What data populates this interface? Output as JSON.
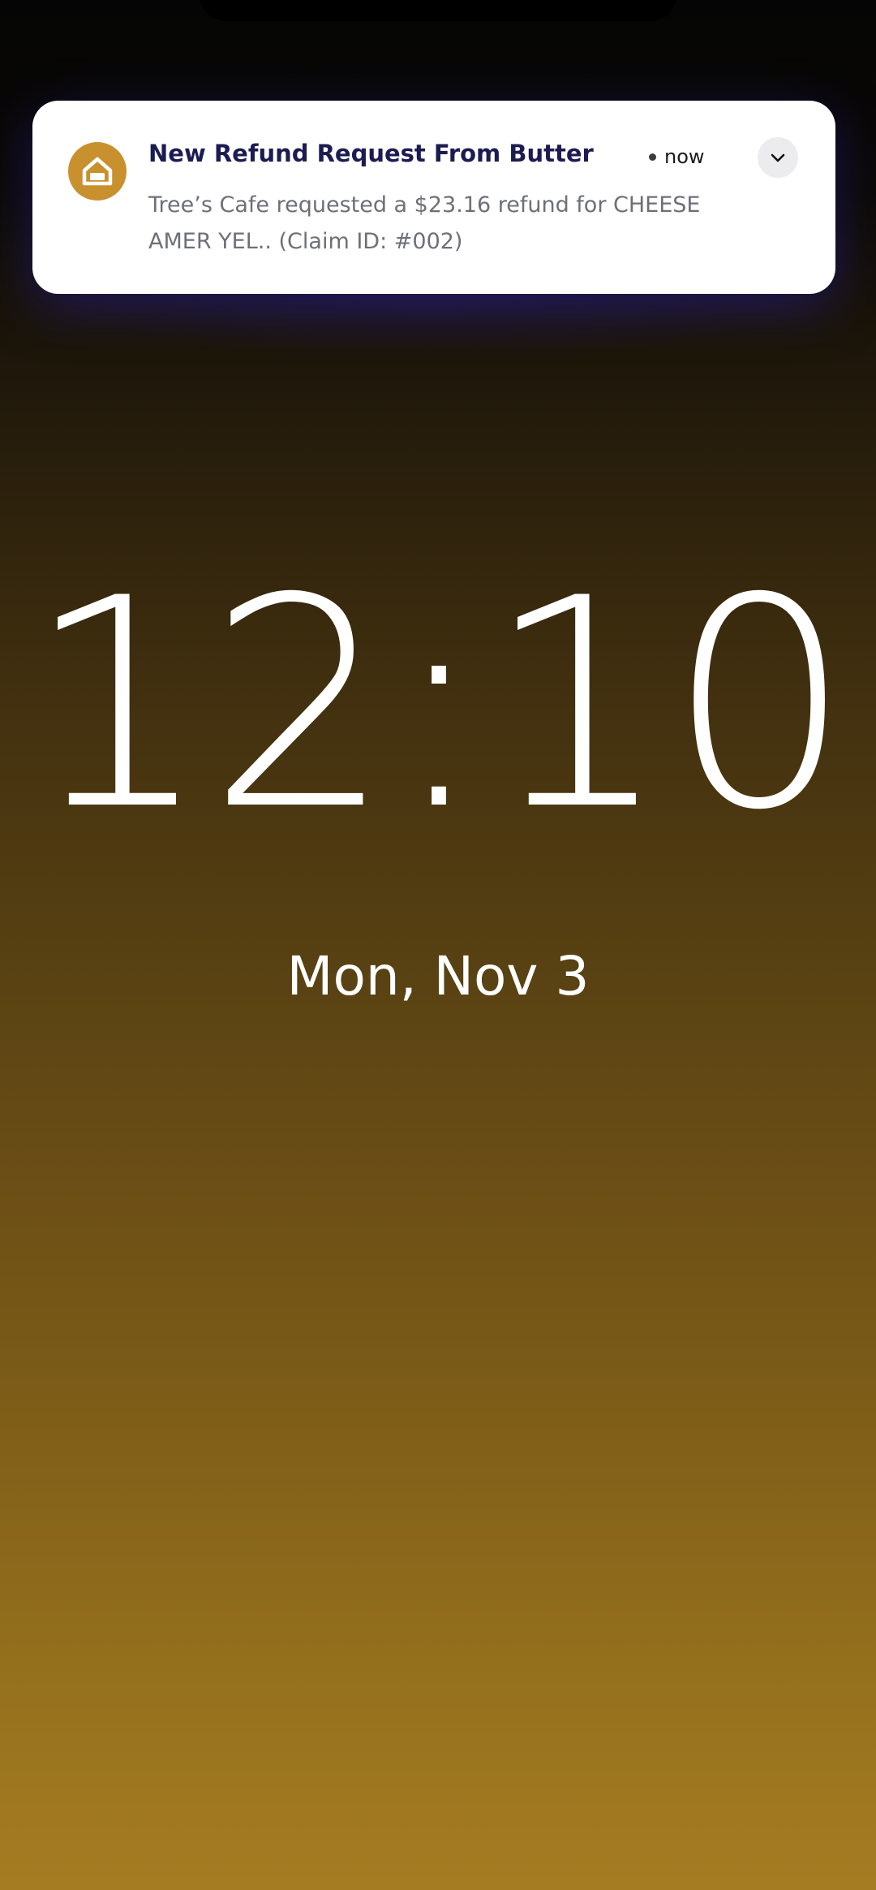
{
  "notification": {
    "app_icon": "house-icon",
    "title": "New Refund Request From Butter",
    "time": "now",
    "body_line1": "Tree’s Cafe requested a $23.16 refund for CHEESE",
    "body_line2": "AMER YEL.. (Claim ID: #002)",
    "expand_icon": "chevron-down-icon"
  },
  "lockscreen": {
    "time": "12:10",
    "date": "Mon, Nov 3"
  },
  "colors": {
    "icon_background": "#c8912e",
    "title_text": "#1c1c52",
    "wallpaper_top": "#050505",
    "wallpaper_bottom": "#a67c22"
  }
}
